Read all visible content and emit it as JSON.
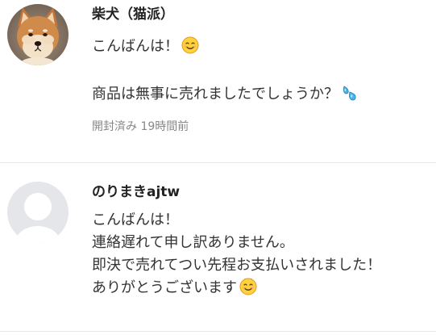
{
  "comments": [
    {
      "username": "柴犬（猫派）",
      "avatar_icon": "shiba-dog-avatar",
      "lines": [
        "こんばんは！",
        "商品は無事に売れましたでしょうか？"
      ],
      "emojis": [
        "smiling-face-icon",
        "sweat-droplets-icon"
      ],
      "meta": "開封済み 19時間前"
    },
    {
      "username": "のりまきajtw",
      "avatar_icon": "default-user-avatar",
      "lines": [
        "こんばんは！",
        "連絡遅れて申し訳ありません。",
        "即決で売れてつい先程お支払いされました！",
        "ありがとうございます"
      ],
      "emojis": [
        "smiling-face-icon"
      ]
    }
  ],
  "colors": {
    "text": "#222222",
    "meta_text": "#888888",
    "divider": "#e6e6e6",
    "default_avatar_bg": "#e4e6e9",
    "default_avatar_fg": "#ffffff",
    "emoji_face": "#ffd23d",
    "emoji_drop": "#4ab4e8"
  }
}
